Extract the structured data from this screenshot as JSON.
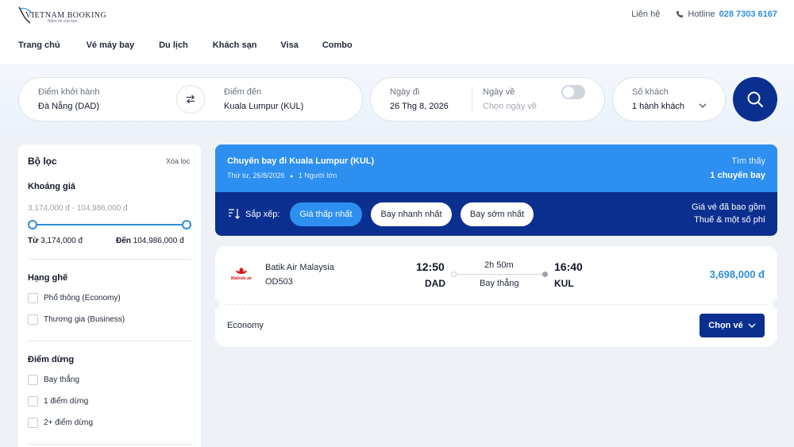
{
  "brand": {
    "logo_text": "VIETNAM BOOKING",
    "tagline": "Niềm tin của bạn"
  },
  "top_links": {
    "contact": "Liên hệ",
    "hotline_label": "Hotline",
    "hotline_number": "028 7303 6167"
  },
  "nav": [
    {
      "label": "Trang chủ"
    },
    {
      "label": "Vé máy bay"
    },
    {
      "label": "Du lịch"
    },
    {
      "label": "Khách sạn"
    },
    {
      "label": "Visa"
    },
    {
      "label": "Combo"
    }
  ],
  "search": {
    "origin_label": "Điểm khởi hành",
    "origin_value": "Đà Nẵng (DAD)",
    "dest_label": "Điểm đến",
    "dest_value": "Kuala Lumpur (KUL)",
    "depart_label": "Ngày đi",
    "depart_value": "26 Thg 8, 2026",
    "return_label": "Ngày về",
    "return_placeholder": "Chọn ngày về",
    "return_toggle_on": false,
    "pax_label": "Số khách",
    "pax_value": "1 hành khách"
  },
  "filter": {
    "title": "Bộ lọc",
    "clear": "Xóa lọc",
    "price": {
      "title": "Khoảng giá",
      "range_text": "3,174,000 đ - 104,986,000 đ",
      "from_label": "Từ",
      "from_value": "3,174,000 đ",
      "to_label": "Đến",
      "to_value": "104,986,000 đ"
    },
    "seat_class": {
      "title": "Hạng ghế",
      "options": [
        "Phổ thông (Economy)",
        "Thương gia (Business)"
      ]
    },
    "stops": {
      "title": "Điểm dừng",
      "options": [
        "Bay thẳng",
        "1 điểm dừng",
        "2+ điểm dừng"
      ]
    }
  },
  "results": {
    "title": "Chuyến bay đi Kuala Lumpur (KUL)",
    "date": "Thứ tư, 26/8/2026",
    "bullet": "●",
    "passengers": "1 Người lớn",
    "found_line1": "Tìm thấy",
    "found_line2": "1 chuyến bay",
    "sort_label": "Sắp xếp:",
    "sort_options": [
      {
        "label": "Giá thấp nhất",
        "active": true
      },
      {
        "label": "Bay nhanh nhất",
        "active": false
      },
      {
        "label": "Bay sớm nhất",
        "active": false
      }
    ],
    "price_note_1": "Giá vé đã bao gồm",
    "price_note_2": "Thuế & một số phí"
  },
  "flight": {
    "airline": "Batik Air Malaysia",
    "airline_logo_text": "Malindo air",
    "flight_no": "OD503",
    "depart_time": "12:50",
    "depart_code": "DAD",
    "arrive_time": "16:40",
    "arrive_code": "KUL",
    "duration": "2h 50m",
    "stops": "Bay thẳng",
    "price": "3,698,000 đ",
    "cabin": "Economy",
    "choose_label": "Chọn vé"
  },
  "colors": {
    "primary_dark": "#0a2f8f",
    "primary": "#2d8ff0",
    "accent_text": "#2d8fd8",
    "airline_red": "#d7141d"
  },
  "icons": {
    "swap": "swap-arrows-icon",
    "search": "search-icon",
    "phone": "phone-icon",
    "chevron": "chevron-down-icon",
    "sort": "sort-icon"
  }
}
